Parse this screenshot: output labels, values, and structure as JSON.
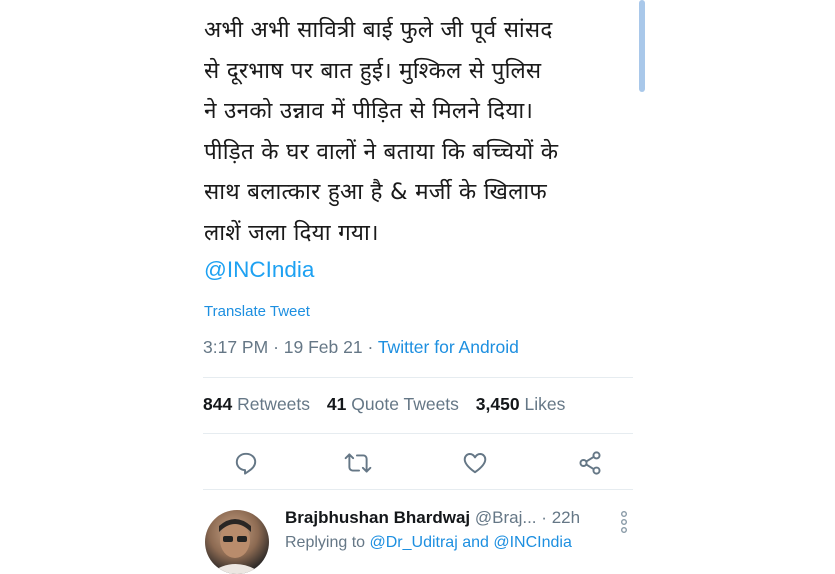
{
  "tweet": {
    "lines": [
      "अभी अभी  सावित्री बाई फुले जी पूर्व सांसद",
      "से दूरभाष पर बात हुई। मुश्किल से पुलिस",
      "ने उनको उन्नाव में पीड़ित से मिलने दिया।",
      "पीड़ित के घर वालों ने बताया कि बच्चियों के",
      "साथ बलात्कार हुआ है & मर्जी के खिलाफ",
      "लाशें जला दिया गया।"
    ],
    "mention": "@INCIndia",
    "translate_label": "Translate Tweet",
    "time": "3:17 PM",
    "date": "19 Feb 21",
    "separator": "·",
    "source": "Twitter for Android"
  },
  "stats": {
    "retweets_count": "844",
    "retweets_label": "Retweets",
    "quotes_count": "41",
    "quotes_label": "Quote Tweets",
    "likes_count": "3,450",
    "likes_label": "Likes"
  },
  "actions": {
    "icons": [
      "reply-icon",
      "retweet-icon",
      "like-icon",
      "share-icon"
    ],
    "color": "#657786"
  },
  "reply": {
    "name": "Brajbhushan Bhardwaj",
    "handle": "@Braj...",
    "separator": "·",
    "age": "22h",
    "replying_prefix": "Replying to",
    "replying_targets": "@Dr_Uditraj and @INCIndia"
  },
  "colors": {
    "link": "#1da1f2",
    "text": "#14171a",
    "muted": "#657786",
    "scrollbar": "#a9c8ea"
  }
}
